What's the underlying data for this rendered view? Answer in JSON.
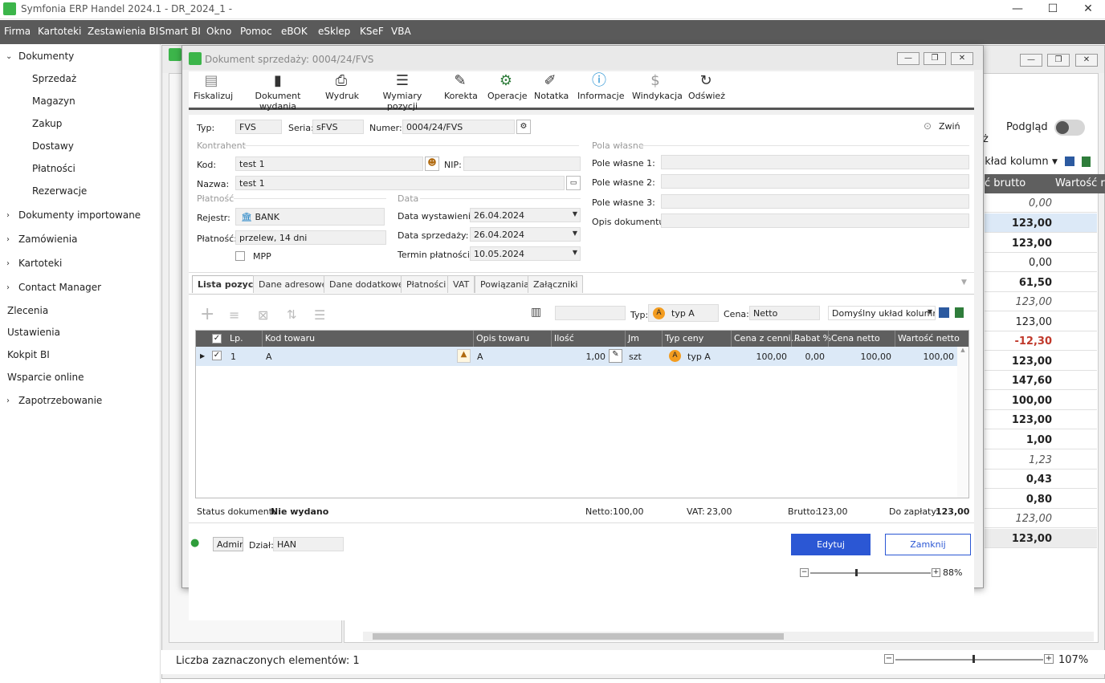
{
  "window": {
    "title": "Symfonia ERP Handel 2024.1 - DR_2024_1 -"
  },
  "menu": [
    "Firma",
    "Kartoteki",
    "Zestawienia BI",
    "Smart BI",
    "Okno",
    "Pomoc",
    "eBOK",
    "eSklep",
    "KSeF",
    "VBA"
  ],
  "sidebar": {
    "group_dokumenty": "Dokumenty",
    "sub": [
      "Sprzedaż",
      "Magazyn",
      "Zakup",
      "Dostawy",
      "Płatności",
      "Rezerwacje"
    ],
    "groups": [
      "Dokumenty importowane",
      "Zamówienia",
      "Kartoteki",
      "Contact Manager"
    ],
    "items": [
      "Zlecenia",
      "Ustawienia",
      "Kokpit BI",
      "Wsparcie online"
    ],
    "last_group": "Zapotrzebowanie"
  },
  "background": {
    "podglad_label": "Podgląd",
    "partial_z": "ż",
    "layout_select": "układ kolumn",
    "col_brutto": "ć brutto",
    "col_wartosc": "Wartość r",
    "values": [
      "0,00",
      "123,00",
      "123,00",
      "0,00",
      "61,50",
      "123,00",
      "123,00",
      "-12,30",
      "123,00",
      "147,60",
      "100,00",
      "123,00",
      "1,00",
      "1,23",
      "0,43",
      "0,80",
      "123,00",
      "123,00"
    ],
    "status_label": "Liczba zaznaczonych elementów: 1",
    "zoom": "107%"
  },
  "modal": {
    "title": "Dokument sprzedaży: 0004/24/FVS",
    "toolbar": [
      "Fiskalizuj",
      "Dokument wydania",
      "Wydruk",
      "Wymiary pozycji",
      "Korekta",
      "Operacje",
      "Notatka",
      "Informacje",
      "Windykacja",
      "Odśwież"
    ],
    "collapse": "Zwiń",
    "typ_label": "Typ:",
    "typ_value": "FVS",
    "seria_label": "Seria:",
    "seria_value": "sFVS",
    "numer_label": "Numer:",
    "numer_value": "0004/24/FVS",
    "kontrahent_group": "Kontrahent",
    "kod_label": "Kod:",
    "kod_value": "test 1",
    "nip_label": "NIP:",
    "nazwa_label": "Nazwa:",
    "nazwa_value": "test 1",
    "platnosc_group": "Płatność",
    "rejestr_label": "Rejestr:",
    "rejestr_value": "BANK",
    "platnosc_label": "Płatność:",
    "platnosc_value": "przelew, 14 dni",
    "mpp_label": "MPP",
    "data_group": "Data",
    "data_wyst_label": "Data wystawienia:",
    "data_wyst_value": "26.04.2024",
    "data_sprz_label": "Data sprzedaży:",
    "data_sprz_value": "26.04.2024",
    "termin_label": "Termin płatności:",
    "termin_value": "10.05.2024",
    "pola_group": "Pola własne",
    "pole1_label": "Pole własne 1:",
    "pole2_label": "Pole własne 2:",
    "pole3_label": "Pole własne 3:",
    "opis_label": "Opis dokumentu:",
    "tabs": [
      "Lista pozycji",
      "Dane adresowe",
      "Dane dodatkowe",
      "Płatności",
      "VAT",
      "Powiązania",
      "Załączniki"
    ],
    "grid_typ_label": "Typ:",
    "grid_typ_value": "typ A",
    "grid_cena_label": "Cena:",
    "grid_cena_value": "Netto",
    "grid_layout": "Domyślny układ kolumn",
    "columns": [
      "Lp.",
      "Kod towaru",
      "Opis towaru",
      "Ilość",
      "Jm",
      "Typ ceny",
      "Cena z cenni...",
      "Rabat %",
      "Cena netto",
      "Wartość netto"
    ],
    "row": {
      "lp": "1",
      "kod": "A",
      "opis": "A",
      "ilosc": "1,00",
      "jm": "szt",
      "typ": "typ A",
      "cena_cennik": "100,00",
      "rabat": "0,00",
      "cena_netto": "100,00",
      "wartosc": "100,00"
    },
    "status_doc_label": "Status dokumentu:",
    "status_doc_value": "Nie wydano",
    "netto_label": "Netto:",
    "netto_value": "100,00",
    "vat_label": "VAT:",
    "vat_value": "23,00",
    "brutto_label": "Brutto:",
    "brutto_value": "123,00",
    "dozaplaty_label": "Do zapłaty:",
    "dozaplaty_value": "123,00",
    "user": "Admin",
    "dzial_label": "Dział:",
    "dzial_value": "HAN",
    "edit_btn": "Edytuj",
    "close_btn": "Zamknij",
    "zoom": "88%"
  },
  "colors": {
    "menubar": "#5a5a5a",
    "accent": "#2b57d4",
    "row_highlight": "#dce9f7",
    "negative": "#c0392b"
  }
}
